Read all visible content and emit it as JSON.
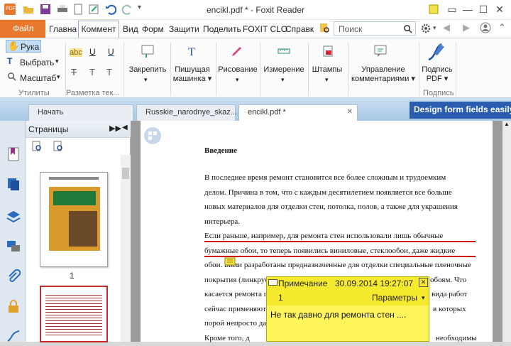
{
  "window": {
    "title": "encikl.pdf * - Foxit Reader"
  },
  "ribbon_tabs": [
    "Файл",
    "Главна",
    "Коммент",
    "Вид",
    "Форм",
    "Защити",
    "Поделить",
    "FOXIT CLO",
    "Справк"
  ],
  "search": {
    "placeholder": "Поиск"
  },
  "ribbon": {
    "hand": "Рука",
    "select": "Выбрать",
    "zoom": "Масштаб",
    "group_utils": "Утилиты",
    "group_markup": "Разметка тек...",
    "pin": "Закрепить",
    "typewriter_1": "Пишущая",
    "typewriter_2": "машинка",
    "drawing": "Рисование",
    "measure": "Измерение",
    "stamps": "Штампы",
    "manage_1": "Управление",
    "manage_2": "комментариями",
    "sign_1": "Подпись",
    "sign_2": "PDF",
    "group_sign": "Подпись"
  },
  "doc_tabs": [
    "Начать",
    "Russkie_narodnye_skaz...",
    "encikl.pdf *"
  ],
  "banner": "Design form fields easily",
  "pages_panel": {
    "title": "Страницы",
    "page1": "1"
  },
  "document": {
    "heading": "Введение",
    "para1": [
      "В последнее время ремонт становится все более сложным и трудоемким",
      "делом. Причина в том, что с каждым десятилетием появляется все больше",
      "новых материалов для отделки стен, потолка, полов, а также для украшения",
      "интерьера."
    ],
    "para2": [
      "Если раньше, например, для ремонта стен использовали лишь обычные",
      "бумажные обои, то теперь появились виниловые, стеклообои, даже жидкие",
      "обои. Были разработаны предназначенные для отделки специальные пленочные",
      "покрытия (линкруст,",
      "касается ремонта по",
      "сейчас применяют са",
      "порой непросто даже с"
    ],
    "para2_right": [
      "обоям. Что",
      "вида работ",
      "в которых"
    ],
    "para3_start": "Кроме того, д",
    "para3_end": "необходимы"
  },
  "note": {
    "title": "Примечание",
    "datetime": "30.09.2014 19:27:07",
    "number": "1",
    "options": "Параметры",
    "text": "Не так давно для ремонта стен ...."
  }
}
